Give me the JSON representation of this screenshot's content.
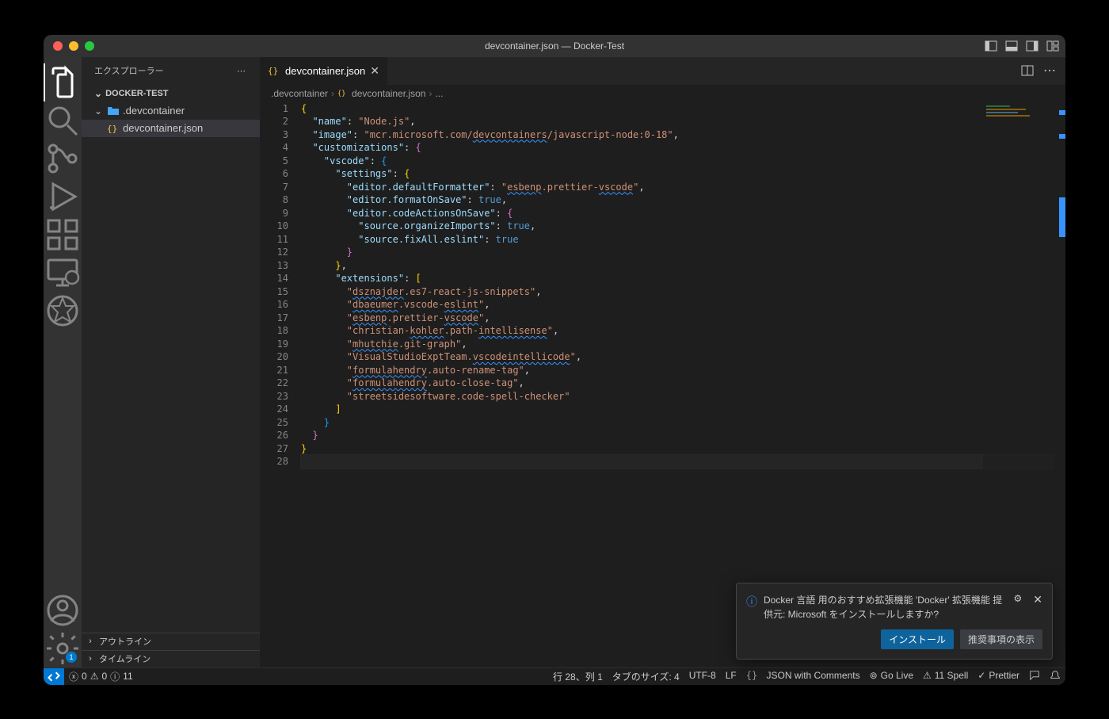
{
  "window_title": "devcontainer.json — Docker-Test",
  "sidebar": {
    "explorer_label": "エクスプローラー",
    "root_name": "DOCKER-TEST",
    "folder_name": ".devcontainer",
    "file_name": "devcontainer.json",
    "outline_label": "アウトライン",
    "timeline_label": "タイムライン"
  },
  "tab": {
    "label": "devcontainer.json"
  },
  "breadcrumbs": {
    "seg1": ".devcontainer",
    "seg2": "devcontainer.json",
    "seg3": "..."
  },
  "code_lines": [
    [
      [
        "{",
        "s-brace"
      ]
    ],
    [
      [
        "  ",
        ""
      ],
      [
        "\"name\"",
        "s-key"
      ],
      [
        ": ",
        "s-punc"
      ],
      [
        "\"Node.js\"",
        "s-str"
      ],
      [
        ",",
        "s-punc"
      ]
    ],
    [
      [
        "  ",
        ""
      ],
      [
        "\"image\"",
        "s-key"
      ],
      [
        ": ",
        "s-punc"
      ],
      [
        "\"mcr.microsoft.com/",
        "s-str"
      ],
      [
        "devcontainers",
        "s-str squig"
      ],
      [
        "/javascript-node:0-18\"",
        "s-str"
      ],
      [
        ",",
        "s-punc"
      ]
    ],
    [
      [
        "  ",
        ""
      ],
      [
        "\"customizations\"",
        "s-key"
      ],
      [
        ": ",
        "s-punc"
      ],
      [
        "{",
        "s-brack"
      ]
    ],
    [
      [
        "    ",
        ""
      ],
      [
        "\"vscode\"",
        "s-key"
      ],
      [
        ": ",
        "s-punc"
      ],
      [
        "{",
        "s-brack2"
      ]
    ],
    [
      [
        "      ",
        ""
      ],
      [
        "\"settings\"",
        "s-key"
      ],
      [
        ": ",
        "s-punc"
      ],
      [
        "{",
        "s-brace"
      ]
    ],
    [
      [
        "        ",
        ""
      ],
      [
        "\"editor.defaultFormatter\"",
        "s-key"
      ],
      [
        ": ",
        "s-punc"
      ],
      [
        "\"",
        "s-str"
      ],
      [
        "esbenp",
        "s-str squig"
      ],
      [
        ".prettier-",
        "s-str"
      ],
      [
        "vscode",
        "s-str squig"
      ],
      [
        "\"",
        "s-str"
      ],
      [
        ",",
        "s-punc"
      ]
    ],
    [
      [
        "        ",
        ""
      ],
      [
        "\"editor.formatOnSave\"",
        "s-key"
      ],
      [
        ": ",
        "s-punc"
      ],
      [
        "true",
        "s-bool"
      ],
      [
        ",",
        "s-punc"
      ]
    ],
    [
      [
        "        ",
        ""
      ],
      [
        "\"editor.codeActionsOnSave\"",
        "s-key"
      ],
      [
        ": ",
        "s-punc"
      ],
      [
        "{",
        "s-brack"
      ]
    ],
    [
      [
        "          ",
        ""
      ],
      [
        "\"source.organizeImports\"",
        "s-key"
      ],
      [
        ": ",
        "s-punc"
      ],
      [
        "true",
        "s-bool"
      ],
      [
        ",",
        "s-punc"
      ]
    ],
    [
      [
        "          ",
        ""
      ],
      [
        "\"source.fixAll.eslint\"",
        "s-key"
      ],
      [
        ": ",
        "s-punc"
      ],
      [
        "true",
        "s-bool"
      ]
    ],
    [
      [
        "        ",
        ""
      ],
      [
        "}",
        "s-brack"
      ]
    ],
    [
      [
        "      ",
        ""
      ],
      [
        "}",
        "s-brace"
      ],
      [
        ",",
        "s-punc"
      ]
    ],
    [
      [
        "      ",
        ""
      ],
      [
        "\"extensions\"",
        "s-key"
      ],
      [
        ": ",
        "s-punc"
      ],
      [
        "[",
        "s-brace"
      ]
    ],
    [
      [
        "        ",
        ""
      ],
      [
        "\"",
        "s-str"
      ],
      [
        "dsznajder",
        "s-str squig"
      ],
      [
        ".es7-react-js-snippets\"",
        "s-str"
      ],
      [
        ",",
        "s-punc"
      ]
    ],
    [
      [
        "        ",
        ""
      ],
      [
        "\"",
        "s-str"
      ],
      [
        "dbaeumer",
        "s-str squig"
      ],
      [
        ".vscode-",
        "s-str"
      ],
      [
        "eslint",
        "s-str squig"
      ],
      [
        "\"",
        "s-str"
      ],
      [
        ",",
        "s-punc"
      ]
    ],
    [
      [
        "        ",
        ""
      ],
      [
        "\"",
        "s-str"
      ],
      [
        "esbenp",
        "s-str squig"
      ],
      [
        ".prettier-",
        "s-str"
      ],
      [
        "vscode",
        "s-str squig"
      ],
      [
        "\"",
        "s-str"
      ],
      [
        ",",
        "s-punc"
      ]
    ],
    [
      [
        "        ",
        ""
      ],
      [
        "\"christian-",
        "s-str"
      ],
      [
        "kohler",
        "s-str squig"
      ],
      [
        ".path-",
        "s-str"
      ],
      [
        "intellisense",
        "s-str squig"
      ],
      [
        "\"",
        "s-str"
      ],
      [
        ",",
        "s-punc"
      ]
    ],
    [
      [
        "        ",
        ""
      ],
      [
        "\"",
        "s-str"
      ],
      [
        "mhutchie",
        "s-str squig"
      ],
      [
        ".git-graph\"",
        "s-str"
      ],
      [
        ",",
        "s-punc"
      ]
    ],
    [
      [
        "        ",
        ""
      ],
      [
        "\"VisualStudioExptTeam.",
        "s-str"
      ],
      [
        "vscodeintellicode",
        "s-str squig"
      ],
      [
        "\"",
        "s-str"
      ],
      [
        ",",
        "s-punc"
      ]
    ],
    [
      [
        "        ",
        ""
      ],
      [
        "\"",
        "s-str"
      ],
      [
        "formulahendry",
        "s-str squig"
      ],
      [
        ".auto-rename-tag\"",
        "s-str"
      ],
      [
        ",",
        "s-punc"
      ]
    ],
    [
      [
        "        ",
        ""
      ],
      [
        "\"",
        "s-str"
      ],
      [
        "formulahendry",
        "s-str squig"
      ],
      [
        ".auto-close-tag\"",
        "s-str"
      ],
      [
        ",",
        "s-punc"
      ]
    ],
    [
      [
        "        ",
        ""
      ],
      [
        "\"streetsidesoftware.code-spell-checker\"",
        "s-str"
      ]
    ],
    [
      [
        "      ",
        ""
      ],
      [
        "]",
        "s-brace"
      ]
    ],
    [
      [
        "    ",
        ""
      ],
      [
        "}",
        "s-brack2"
      ]
    ],
    [
      [
        "  ",
        ""
      ],
      [
        "}",
        "s-brack"
      ]
    ],
    [
      [
        "}",
        "s-brace"
      ]
    ],
    [
      [
        "",
        ""
      ]
    ]
  ],
  "statusbar": {
    "errors": "0",
    "warnings": "0",
    "info": "11",
    "cursor": "行 28、列 1",
    "tabsize": "タブのサイズ: 4",
    "encoding": "UTF-8",
    "eol": "LF",
    "language": "JSON with Comments",
    "golive": "Go Live",
    "spell": "11 Spell",
    "prettier": "Prettier"
  },
  "toast": {
    "message": "Docker 言語 用のおすすめ拡張機能 'Docker' 拡張機能 提供元: Microsoft をインストールしますか?",
    "install": "インストール",
    "recommendations": "推奨事項の表示"
  },
  "activity_badge": "1"
}
